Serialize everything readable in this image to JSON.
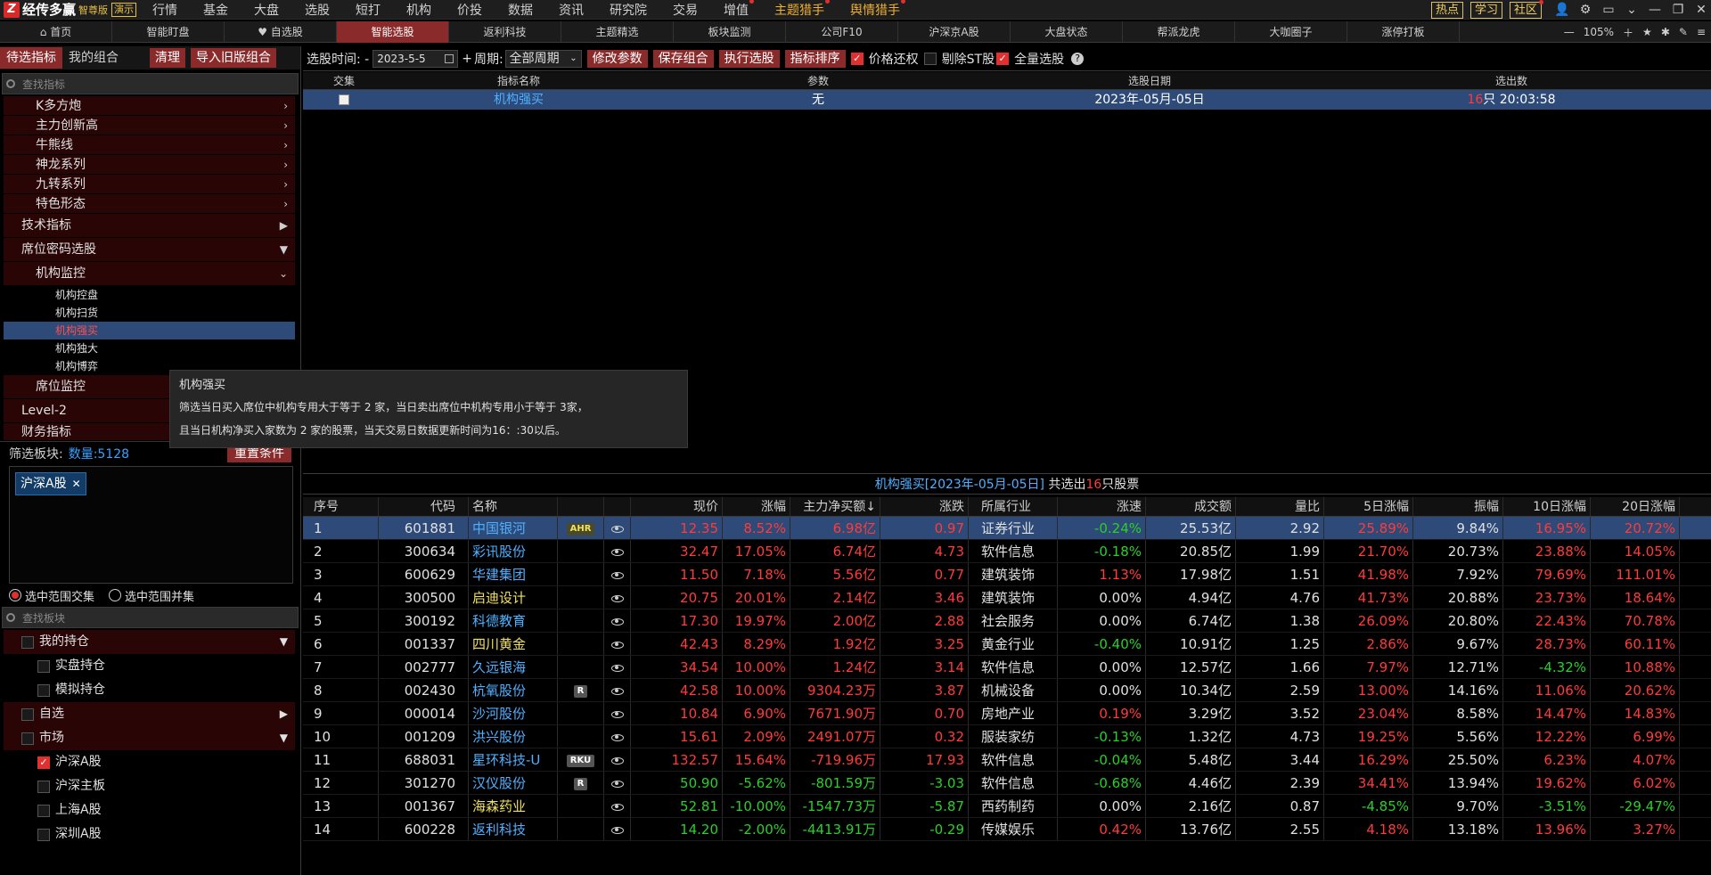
{
  "app": {
    "logo_text": "经传多赢",
    "edition": "智尊版",
    "demo_badge": "演示"
  },
  "menu": [
    {
      "label": "行情",
      "highlight": false,
      "dot": false
    },
    {
      "label": "基金",
      "highlight": false,
      "dot": false
    },
    {
      "label": "大盘",
      "highlight": false,
      "dot": false
    },
    {
      "label": "选股",
      "highlight": false,
      "dot": false
    },
    {
      "label": "短打",
      "highlight": false,
      "dot": false
    },
    {
      "label": "机构",
      "highlight": false,
      "dot": false
    },
    {
      "label": "价投",
      "highlight": false,
      "dot": false
    },
    {
      "label": "数据",
      "highlight": false,
      "dot": false
    },
    {
      "label": "资讯",
      "highlight": false,
      "dot": false
    },
    {
      "label": "研究院",
      "highlight": false,
      "dot": false
    },
    {
      "label": "交易",
      "highlight": false,
      "dot": false
    },
    {
      "label": "增值",
      "highlight": false,
      "dot": true
    },
    {
      "label": "主题猎手",
      "highlight": true,
      "dot": true
    },
    {
      "label": "舆情猎手",
      "highlight": true,
      "dot": true
    }
  ],
  "top_right": {
    "hot": "热点",
    "learn": "学习",
    "community": "社区"
  },
  "tabs": [
    {
      "label": "首页",
      "icon": "home-icon",
      "active": false,
      "width": 126
    },
    {
      "label": "智能盯盘",
      "icon": "",
      "active": false,
      "width": 126
    },
    {
      "label": "自选股",
      "icon": "heart-icon",
      "active": false,
      "width": 126
    },
    {
      "label": "智能选股",
      "icon": "",
      "active": true,
      "width": 126
    },
    {
      "label": "返利科技",
      "icon": "",
      "active": false,
      "width": 126
    },
    {
      "label": "主题精选",
      "icon": "",
      "active": false,
      "width": 126
    },
    {
      "label": "板块监测",
      "icon": "",
      "active": false,
      "width": 126
    },
    {
      "label": "公司F10",
      "icon": "",
      "active": false,
      "width": 126
    },
    {
      "label": "沪深京A股",
      "icon": "",
      "active": false,
      "width": 126
    },
    {
      "label": "大盘状态",
      "icon": "",
      "active": false,
      "width": 126
    },
    {
      "label": "帮派龙虎",
      "icon": "",
      "active": false,
      "width": 126
    },
    {
      "label": "大咖圈子",
      "icon": "",
      "active": false,
      "width": 126
    },
    {
      "label": "涨停打板",
      "icon": "",
      "active": false,
      "width": 126
    }
  ],
  "zoom": "105%",
  "left_panel": {
    "tab_pending": "待选指标",
    "tab_mine": "我的组合",
    "btn_clear": "清理",
    "btn_import": "导入旧版组合",
    "search_placeholder": "查找指标",
    "tree_subs": [
      {
        "label": "K多方炮"
      },
      {
        "label": "主力创新高"
      },
      {
        "label": "牛熊线"
      },
      {
        "label": "神龙系列"
      },
      {
        "label": "九转系列"
      },
      {
        "label": "特色形态"
      }
    ],
    "tree_tech": "技术指标",
    "tree_seat": "席位密码选股",
    "tree_inst_monitor": "机构监控",
    "tree_leaves": [
      {
        "label": "机构控盘",
        "selected": false
      },
      {
        "label": "机构扫货",
        "selected": false
      },
      {
        "label": "机构强买",
        "selected": true
      },
      {
        "label": "机构独大",
        "selected": false
      },
      {
        "label": "机构博弈",
        "selected": false
      }
    ],
    "tree_seat_monitor": "席位监控",
    "tree_level2": "Level-2",
    "tree_finance": "财务指标",
    "filter_label": "筛选板块:",
    "filter_count": "数量:5128",
    "reset_btn": "重置条件",
    "chip": "沪深A股",
    "radio_intersect": "选中范围交集",
    "radio_union": "选中范围并集",
    "search_block_placeholder": "查找板块",
    "groups": {
      "my_holdings": "我的持仓",
      "real_holdings": "实盘持仓",
      "sim_holdings": "模拟持仓",
      "watchlist": "自选",
      "market": "市场",
      "sh_sz_a": "沪深A股",
      "sh_sz_main": "沪深主板",
      "sh_a": "上海A股",
      "sz_a": "深圳A股"
    }
  },
  "toolbar": {
    "date_label": "选股时间: -",
    "date_value": "2023-5-5",
    "plus": "+",
    "period_label": "周期:",
    "period_value": "全部周期",
    "btn_modify": "修改参数",
    "btn_save": "保存组合",
    "btn_execute": "执行选股",
    "btn_sort": "指标排序",
    "cb_price_restore": "价格还权",
    "cb_remove_st": "剔除ST股",
    "cb_full": "全量选股",
    "help": "?"
  },
  "upper_table": {
    "headers": [
      "交集",
      "指标名称",
      "参数",
      "选股日期",
      "选出数"
    ],
    "row": {
      "name": "机构强买",
      "param": "无",
      "date": "2023年-05月-05日",
      "count": "16",
      "count_suffix": "只 20:03:58"
    }
  },
  "tooltip": {
    "title": "机构强买",
    "line1": "筛选当日买入席位中机构专用大于等于 2 家，当日卖出席位中机构专用小于等于 3家，",
    "line2": "且当日机构净买入家数为 2 家的股票，当天交易日数据更新时间为16：:30以后。"
  },
  "result_title": {
    "prefix": "机构强买[2023年-05月-05日]",
    "mid": " 共选出",
    "count": "16",
    "suffix": "只股票"
  },
  "lower_table": {
    "headers": [
      "序号",
      "代码",
      "名称",
      "",
      "",
      "现价",
      "涨幅",
      "主力净买额↓",
      "涨跌",
      "所属行业",
      "涨速",
      "成交额",
      "量比",
      "5日涨幅",
      "振幅",
      "10日涨幅",
      "20日涨幅"
    ],
    "rows": [
      {
        "seq": "1",
        "code": "601881",
        "name": "中国银河",
        "name_color": "blue",
        "tag": "AHR",
        "price": "12.35",
        "pct": "8.52%",
        "net": "6.98亿",
        "chg": "0.97",
        "ind": "证券行业",
        "speed": "-0.24%",
        "vol": "25.53亿",
        "ratio": "2.92",
        "p5": "25.89%",
        "amp": "9.84%",
        "p10": "16.95%",
        "p20": "20.72%",
        "dir": "up",
        "speed_dir": "down",
        "p5_dir": "up",
        "p10_dir": "up",
        "p20_dir": "up",
        "selected": true
      },
      {
        "seq": "2",
        "code": "300634",
        "name": "彩讯股份",
        "name_color": "blue",
        "tag": "",
        "price": "32.47",
        "pct": "17.05%",
        "net": "6.74亿",
        "chg": "4.73",
        "ind": "软件信息",
        "speed": "-0.18%",
        "vol": "20.85亿",
        "ratio": "1.99",
        "p5": "21.70%",
        "amp": "20.73%",
        "p10": "23.88%",
        "p20": "14.05%",
        "dir": "up",
        "speed_dir": "down",
        "p5_dir": "up",
        "p10_dir": "up",
        "p20_dir": "up",
        "selected": false
      },
      {
        "seq": "3",
        "code": "600629",
        "name": "华建集团",
        "name_color": "blue",
        "tag": "",
        "price": "11.50",
        "pct": "7.18%",
        "net": "5.56亿",
        "chg": "0.77",
        "ind": "建筑装饰",
        "speed": "1.13%",
        "vol": "17.98亿",
        "ratio": "1.51",
        "p5": "41.98%",
        "amp": "7.92%",
        "p10": "79.69%",
        "p20": "111.01%",
        "dir": "up",
        "speed_dir": "up",
        "p5_dir": "up",
        "p10_dir": "up",
        "p20_dir": "up",
        "selected": false
      },
      {
        "seq": "4",
        "code": "300500",
        "name": "启迪设计",
        "name_color": "yellow",
        "tag": "",
        "price": "20.75",
        "pct": "20.01%",
        "net": "2.14亿",
        "chg": "3.46",
        "ind": "建筑装饰",
        "speed": "0.00%",
        "vol": "4.94亿",
        "ratio": "4.76",
        "p5": "41.73%",
        "amp": "20.88%",
        "p10": "23.73%",
        "p20": "18.64%",
        "dir": "up",
        "speed_dir": "flat",
        "p5_dir": "up",
        "p10_dir": "up",
        "p20_dir": "up",
        "selected": false
      },
      {
        "seq": "5",
        "code": "300192",
        "name": "科德教育",
        "name_color": "blue",
        "tag": "",
        "price": "17.30",
        "pct": "19.97%",
        "net": "2.00亿",
        "chg": "2.88",
        "ind": "社会服务",
        "speed": "0.00%",
        "vol": "6.74亿",
        "ratio": "1.38",
        "p5": "26.09%",
        "amp": "20.80%",
        "p10": "22.43%",
        "p20": "70.78%",
        "dir": "up",
        "speed_dir": "flat",
        "p5_dir": "up",
        "p10_dir": "up",
        "p20_dir": "up",
        "selected": false
      },
      {
        "seq": "6",
        "code": "001337",
        "name": "四川黄金",
        "name_color": "yellow",
        "tag": "",
        "price": "42.43",
        "pct": "8.29%",
        "net": "1.92亿",
        "chg": "3.25",
        "ind": "黄金行业",
        "speed": "-0.40%",
        "vol": "10.91亿",
        "ratio": "1.25",
        "p5": "2.86%",
        "amp": "9.67%",
        "p10": "28.73%",
        "p20": "60.11%",
        "dir": "up",
        "speed_dir": "down",
        "p5_dir": "up",
        "p10_dir": "up",
        "p20_dir": "up",
        "selected": false
      },
      {
        "seq": "7",
        "code": "002777",
        "name": "久远银海",
        "name_color": "blue",
        "tag": "",
        "price": "34.54",
        "pct": "10.00%",
        "net": "1.24亿",
        "chg": "3.14",
        "ind": "软件信息",
        "speed": "0.00%",
        "vol": "12.57亿",
        "ratio": "1.66",
        "p5": "7.97%",
        "amp": "12.71%",
        "p10": "-4.32%",
        "p20": "10.88%",
        "dir": "up",
        "speed_dir": "flat",
        "p5_dir": "up",
        "p10_dir": "down",
        "p20_dir": "up",
        "selected": false
      },
      {
        "seq": "8",
        "code": "002430",
        "name": "杭氧股份",
        "name_color": "blue",
        "tag": "R",
        "price": "42.58",
        "pct": "10.00%",
        "net": "9304.23万",
        "chg": "3.87",
        "ind": "机械设备",
        "speed": "0.00%",
        "vol": "10.34亿",
        "ratio": "2.59",
        "p5": "13.00%",
        "amp": "14.16%",
        "p10": "11.06%",
        "p20": "20.62%",
        "dir": "up",
        "speed_dir": "flat",
        "p5_dir": "up",
        "p10_dir": "up",
        "p20_dir": "up",
        "selected": false
      },
      {
        "seq": "9",
        "code": "000014",
        "name": "沙河股份",
        "name_color": "blue",
        "tag": "",
        "price": "10.84",
        "pct": "6.90%",
        "net": "7671.90万",
        "chg": "0.70",
        "ind": "房地产业",
        "speed": "0.19%",
        "vol": "3.29亿",
        "ratio": "3.52",
        "p5": "23.04%",
        "amp": "8.58%",
        "p10": "14.47%",
        "p20": "14.83%",
        "dir": "up",
        "speed_dir": "up",
        "p5_dir": "up",
        "p10_dir": "up",
        "p20_dir": "up",
        "selected": false
      },
      {
        "seq": "10",
        "code": "001209",
        "name": "洪兴股份",
        "name_color": "blue",
        "tag": "",
        "price": "15.61",
        "pct": "2.09%",
        "net": "2491.07万",
        "chg": "0.32",
        "ind": "服装家纺",
        "speed": "-0.13%",
        "vol": "1.32亿",
        "ratio": "4.73",
        "p5": "19.25%",
        "amp": "5.56%",
        "p10": "12.22%",
        "p20": "6.99%",
        "dir": "up",
        "speed_dir": "down",
        "p5_dir": "up",
        "p10_dir": "up",
        "p20_dir": "up",
        "selected": false
      },
      {
        "seq": "11",
        "code": "688031",
        "name": "星环科技-U",
        "name_color": "blue",
        "tag": "RKU",
        "price": "132.57",
        "pct": "15.64%",
        "net": "-719.96万",
        "chg": "17.93",
        "ind": "软件信息",
        "speed": "-0.04%",
        "vol": "5.48亿",
        "ratio": "3.44",
        "p5": "16.29%",
        "amp": "25.50%",
        "p10": "6.23%",
        "p20": "4.07%",
        "dir": "up",
        "speed_dir": "down",
        "p5_dir": "up",
        "p10_dir": "up",
        "p20_dir": "up",
        "selected": false
      },
      {
        "seq": "12",
        "code": "301270",
        "name": "汉仪股份",
        "name_color": "blue",
        "tag": "R",
        "price": "50.90",
        "pct": "-5.62%",
        "net": "-801.59万",
        "chg": "-3.03",
        "ind": "软件信息",
        "speed": "-0.68%",
        "vol": "4.46亿",
        "ratio": "2.39",
        "p5": "34.41%",
        "amp": "13.94%",
        "p10": "19.62%",
        "p20": "6.02%",
        "dir": "down",
        "speed_dir": "down",
        "p5_dir": "up",
        "p10_dir": "up",
        "p20_dir": "up",
        "selected": false
      },
      {
        "seq": "13",
        "code": "001367",
        "name": "海森药业",
        "name_color": "yellow",
        "tag": "",
        "price": "52.81",
        "pct": "-10.00%",
        "net": "-1547.73万",
        "chg": "-5.87",
        "ind": "西药制药",
        "speed": "0.00%",
        "vol": "2.16亿",
        "ratio": "0.87",
        "p5": "-4.85%",
        "amp": "9.70%",
        "p10": "-3.51%",
        "p20": "-29.47%",
        "dir": "down",
        "speed_dir": "flat",
        "p5_dir": "down",
        "p10_dir": "down",
        "p20_dir": "down",
        "selected": false
      },
      {
        "seq": "14",
        "code": "600228",
        "name": "返利科技",
        "name_color": "blue",
        "tag": "",
        "price": "14.20",
        "pct": "-2.00%",
        "net": "-4413.91万",
        "chg": "-0.29",
        "ind": "传媒娱乐",
        "speed": "0.42%",
        "vol": "13.76亿",
        "ratio": "2.55",
        "p5": "4.18%",
        "amp": "13.18%",
        "p10": "13.96%",
        "p20": "3.27%",
        "dir": "down",
        "speed_dir": "up",
        "p5_dir": "up",
        "p10_dir": "up",
        "p20_dir": "up",
        "selected": false
      }
    ]
  },
  "colors": {
    "up": "#ff3b3b",
    "down": "#2ad02a",
    "accent_red": "#8b2a2a",
    "selection_blue": "#2d4a78",
    "link_blue": "#4fb0ff"
  }
}
